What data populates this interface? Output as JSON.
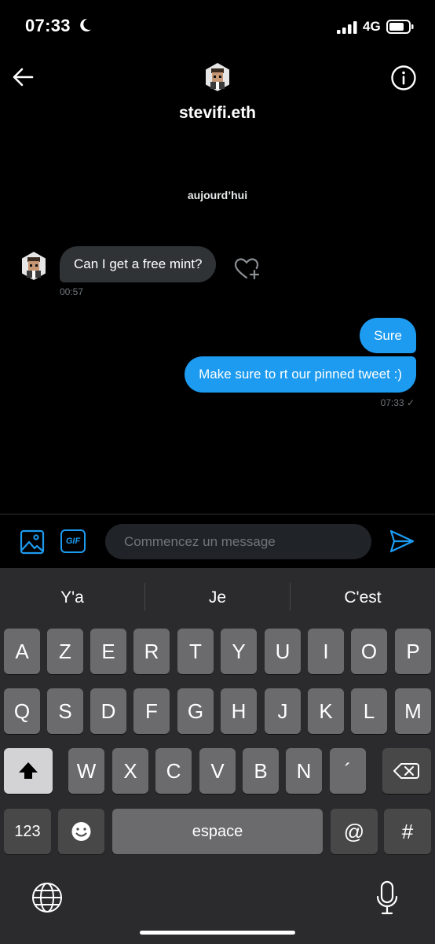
{
  "status_bar": {
    "time": "07:33",
    "network": "4G"
  },
  "header": {
    "name": "stevifi.eth"
  },
  "thread": {
    "date_separator": "aujourd’hui",
    "incoming": {
      "text": "Can I get a free mint?",
      "time": "00:57"
    },
    "outgoing": [
      {
        "text": "Sure"
      },
      {
        "text": "Make sure to rt our pinned tweet :)"
      }
    ],
    "outgoing_time": "07:33 ✓"
  },
  "composer": {
    "gif_label": "GIF",
    "placeholder": "Commencez un message"
  },
  "keyboard": {
    "suggestions": [
      "Y'a",
      "Je",
      "C'est"
    ],
    "row1": [
      "A",
      "Z",
      "E",
      "R",
      "T",
      "Y",
      "U",
      "I",
      "O",
      "P"
    ],
    "row2": [
      "Q",
      "S",
      "D",
      "F",
      "G",
      "H",
      "J",
      "K",
      "L",
      "M"
    ],
    "row3": [
      "W",
      "X",
      "C",
      "V",
      "B",
      "N",
      "´"
    ],
    "numbers_label": "123",
    "space_label": "espace",
    "at_label": "@",
    "hash_label": "#"
  },
  "colors": {
    "accent": "#1d9bf0",
    "bubble_in": "#2f3336",
    "background": "#000000"
  }
}
